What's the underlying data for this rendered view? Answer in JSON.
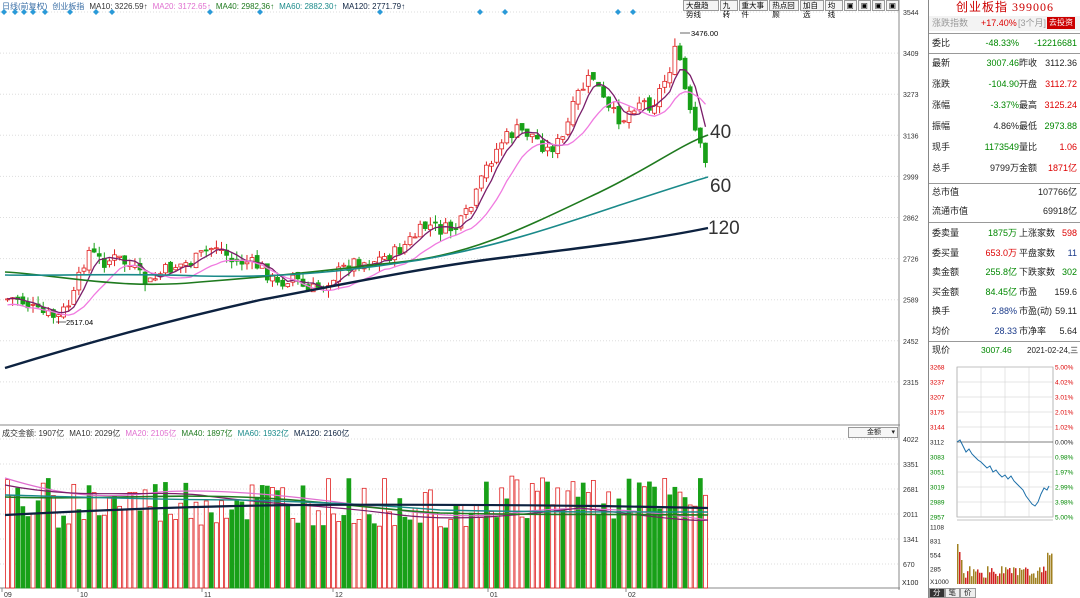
{
  "main": {
    "legend": [
      {
        "text": "日线(前复权)",
        "color": "#3a6ea5"
      },
      {
        "text": "创业板指",
        "color": "#3a6ea5"
      },
      {
        "text": "MA10: 3226.59↑",
        "color": "#333333"
      },
      {
        "text": "MA20: 3172.65↑",
        "color": "#e070d0"
      },
      {
        "text": "MA40: 2982.36↑",
        "color": "#1f7a1f"
      },
      {
        "text": "MA60: 2882.30↑",
        "color": "#1a8a8a"
      },
      {
        "text": "MA120: 2771.79↑",
        "color": "#0d2240"
      }
    ],
    "toolbar": [
      "大盘趋势线",
      "九转",
      "重大事件",
      "热点回顾",
      "加自选",
      "均线",
      "▣",
      "▣",
      "▣",
      "▣"
    ],
    "y_ticks": [
      "3544",
      "3409",
      "3273",
      "3136",
      "2999",
      "2862",
      "2726",
      "2589",
      "2452",
      "2315"
    ],
    "annotations": {
      "high": "3476.00",
      "low": "2517.04",
      "ma40_label": "40",
      "ma60_label": "60",
      "ma120_label": "120"
    },
    "x_labels": [
      "09",
      "10",
      "11",
      "12",
      "01",
      "02"
    ]
  },
  "volume": {
    "legend": [
      {
        "text": "成交金额: 1907亿",
        "color": "#333333"
      },
      {
        "text": "MA10: 2029亿",
        "color": "#333333"
      },
      {
        "text": "MA20: 2105亿",
        "color": "#e070d0"
      },
      {
        "text": "MA40: 1897亿",
        "color": "#1f7a1f"
      },
      {
        "text": "MA60: 1932亿",
        "color": "#1a8a8a"
      },
      {
        "text": "MA120: 2160亿",
        "color": "#0d2240"
      }
    ],
    "selector": "金额",
    "y_ticks": [
      "4022",
      "3351",
      "2681",
      "2011",
      "1341",
      "670"
    ],
    "unit": "X100"
  },
  "panel": {
    "title": "创业板指 399006",
    "rank_label": "涨跌指数",
    "rank_value": "+17.40%",
    "rank_period": "[3个月]",
    "rank_button": "去投资",
    "wb": {
      "label": "委比",
      "value": "-48.33%",
      "diff": "-12216681"
    },
    "rows": [
      {
        "l1": "最新",
        "v1": "3007.46",
        "c1": "green",
        "l2": "昨收",
        "v2": "3112.36",
        "c2": "black"
      },
      {
        "l1": "涨跌",
        "v1": "-104.90",
        "c1": "green",
        "l2": "开盘",
        "v2": "3112.72",
        "c2": "red"
      },
      {
        "l1": "涨幅",
        "v1": "-3.37%",
        "c1": "green",
        "l2": "最高",
        "v2": "3125.24",
        "c2": "red"
      },
      {
        "l1": "振幅",
        "v1": "4.86%",
        "c1": "black",
        "l2": "最低",
        "v2": "2973.88",
        "c2": "green"
      },
      {
        "l1": "现手",
        "v1": "1173549",
        "c1": "green",
        "l2": "量比",
        "v2": "1.06",
        "c2": "red"
      },
      {
        "l1": "总手",
        "v1": "9799万",
        "c1": "black",
        "l2": "金额",
        "v2": "1871亿",
        "c2": "red"
      }
    ],
    "caps": [
      {
        "l": "总市值",
        "v": "107766亿"
      },
      {
        "l": "流通市值",
        "v": "69918亿"
      }
    ],
    "stats": [
      {
        "l1": "委卖量",
        "v1": "1875万",
        "c1": "green",
        "l2": "上涨家数",
        "v2": "598",
        "c2": "red"
      },
      {
        "l1": "委买量",
        "v1": "653.0万",
        "c1": "red",
        "l2": "平盘家数",
        "v2": "11",
        "c2": "blue"
      },
      {
        "l1": "卖金额",
        "v1": "255.8亿",
        "c1": "green",
        "l2": "下跌家数",
        "v2": "302",
        "c2": "green"
      },
      {
        "l1": "买金额",
        "v1": "84.45亿",
        "c1": "green",
        "l2": "市盈",
        "v2": "159.6",
        "c2": "black"
      },
      {
        "l1": "换手",
        "v1": "2.88%",
        "c1": "blue",
        "l2": "市盈(动)",
        "v2": "59.11",
        "c2": "black"
      },
      {
        "l1": "均价",
        "v1": "28.33",
        "c1": "blue",
        "l2": "市净率",
        "v2": "5.64",
        "c2": "black"
      }
    ],
    "now": {
      "label": "现价",
      "price": "3007.46",
      "date": "2021-02-24,三"
    },
    "mini_left": [
      "3268",
      "3237",
      "3207",
      "3175",
      "3144",
      "3112",
      "3083",
      "3051",
      "3019",
      "2989",
      "2957"
    ],
    "mini_right": [
      "5.00%",
      "4.02%",
      "3.01%",
      "2.01%",
      "1.02%",
      "0.00%",
      "0.98%",
      "1.97%",
      "2.99%",
      "3.98%",
      "5.00%"
    ],
    "mini_vol": [
      "1108",
      "831",
      "554",
      "285"
    ],
    "mini_vol_unit": "X1000",
    "tabs": [
      "分",
      "笔",
      "价"
    ]
  }
}
